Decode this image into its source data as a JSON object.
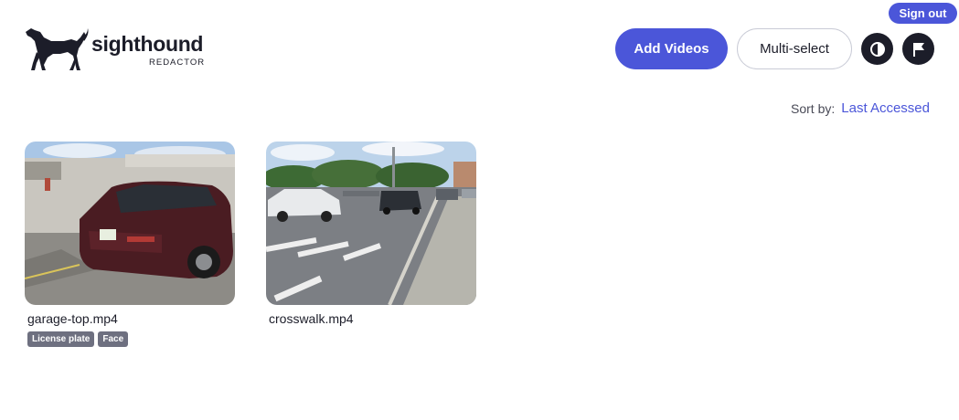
{
  "brand": {
    "name": "sighthound",
    "subtitle": "REDACTOR",
    "logo_icon": "greyhound-dog-icon"
  },
  "header": {
    "sign_out_label": "Sign out",
    "add_videos_label": "Add Videos",
    "multi_select_label": "Multi-select",
    "contrast_icon": "contrast-icon",
    "flag_icon": "flag-icon"
  },
  "sort": {
    "label": "Sort by:",
    "value": "Last Accessed"
  },
  "videos": [
    {
      "filename": "garage-top.mp4",
      "tags": [
        "License plate",
        "Face"
      ]
    },
    {
      "filename": "crosswalk.mp4",
      "tags": []
    }
  ],
  "colors": {
    "accent": "#4b56d9",
    "dark": "#1c1d29",
    "tag_bg": "#6e7080"
  }
}
